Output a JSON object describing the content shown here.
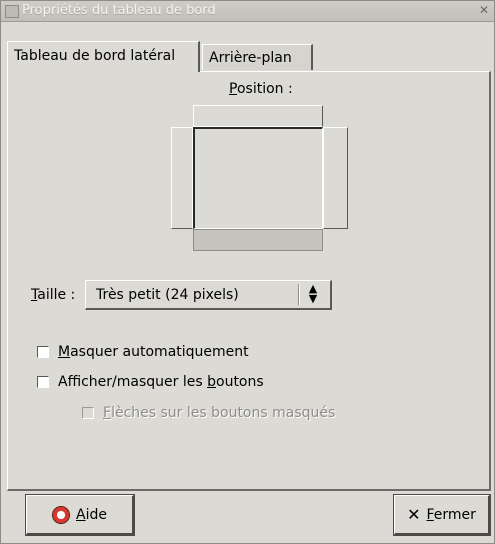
{
  "window": {
    "title": "Propriétés du tableau de bord"
  },
  "tabs": [
    {
      "label": "Tableau de bord latéral"
    },
    {
      "label": "Arrière-plan"
    }
  ],
  "position": {
    "label_mnemonic": "P",
    "label_rest": "osition :"
  },
  "size": {
    "label_mnemonic": "T",
    "label_rest": "aille :",
    "selected_value": "Très petit (24 pixels)"
  },
  "options": {
    "autohide": {
      "mnemonic": "M",
      "rest": "asquer automatiquement",
      "checked": false
    },
    "hide_buttons": {
      "prefix": "Afficher/masquer les ",
      "mnemonic": "b",
      "rest": "outons",
      "checked": false
    },
    "arrows": {
      "mnemonic": "F",
      "rest": "lèches sur les boutons masqués",
      "checked": false,
      "disabled": true
    }
  },
  "buttons": {
    "help": {
      "mnemonic": "A",
      "rest": "ide",
      "icon": "lifebuoy-icon"
    },
    "close": {
      "mnemonic": "F",
      "rest": "ermer",
      "icon": "close-icon"
    }
  },
  "colors": {
    "background": "#dcdad5",
    "titlebar": "#c8c5bf",
    "disabled_text": "#8e8c87"
  }
}
